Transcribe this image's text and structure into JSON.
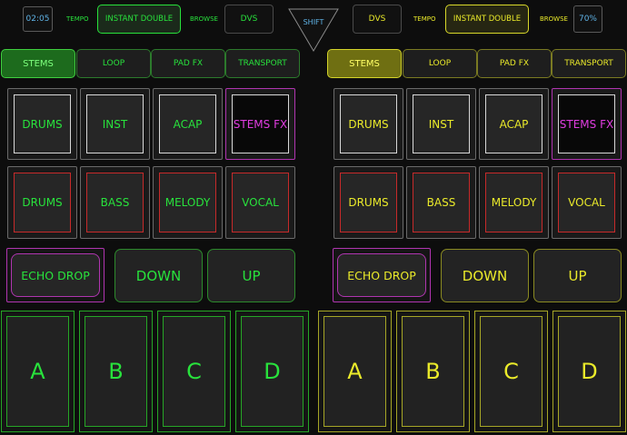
{
  "top": {
    "left_time": "02:05",
    "left_tempo_label": "TEMPO",
    "left_mode": "INSTANT DOUBLE",
    "left_browse_label": "BROWSE",
    "left_dvs": "DVS",
    "shift": "SHIFT",
    "right_dvs": "DVS",
    "right_tempo_label": "TEMPO",
    "right_mode": "INSTANT DOUBLE",
    "right_browse_label": "BROWSE",
    "right_percent": "70%"
  },
  "tabs": [
    "STEMS",
    "LOOP",
    "PAD FX",
    "TRANSPORT"
  ],
  "pads_row1": [
    "DRUMS",
    "INST",
    "ACAP",
    "STEMS FX"
  ],
  "pads_row2": [
    "DRUMS",
    "BASS",
    "MELODY",
    "VOCAL"
  ],
  "controls": {
    "echo_drop": "ECHO DROP",
    "down": "DOWN",
    "up": "UP"
  },
  "hotcues": [
    "A",
    "B",
    "C",
    "D"
  ],
  "colors": {
    "left_accent": "#28e23c",
    "right_accent": "#eaea2a",
    "fx_accent": "#e13de1",
    "info_text": "#5fb3e6",
    "pad_border_white": "#d8d8d8",
    "pad_border_red": "#c62a2a"
  }
}
